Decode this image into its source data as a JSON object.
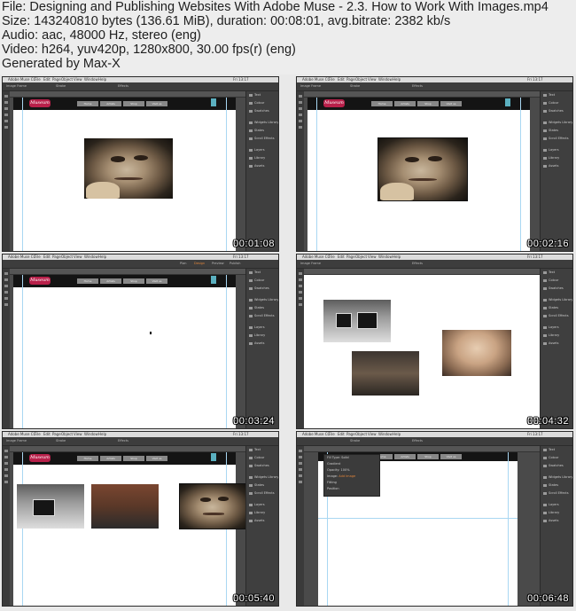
{
  "header": {
    "file_line": "File: Designing and Publishing Websites With Adobe Muse - 2.3. How to Work With Images.mp4",
    "size_line": "Size: 143240810 bytes (136.61 MiB), duration: 00:08:01, avg.bitrate: 2382 kb/s",
    "audio_line": "Audio: aac, 48000 Hz, stereo (eng)",
    "video_line": "Video: h264, yuv420p, 1280x800, 30.00 fps(r) (eng)",
    "generated_line": "Generated by Max-X"
  },
  "app": {
    "name": "Adobe Muse CC",
    "menu": [
      "File",
      "Edit",
      "Page",
      "Object",
      "View",
      "Window",
      "Help"
    ],
    "clock": "Fri 13:17",
    "modes": [
      "Plan",
      "Design",
      "Preview",
      "Publish"
    ],
    "options_label": "Image Frame",
    "options_fields": [
      "Stroke",
      "Effects",
      "Spacing",
      "Wrap"
    ],
    "site_logo": "Museum",
    "site_nav": [
      "Home",
      "Artists",
      "Shop",
      "Visit us"
    ],
    "panels": [
      "Text",
      "Colour",
      "Swatches",
      "Widgets Library",
      "States",
      "Scroll Effects",
      "Layers",
      "Library",
      "Assets"
    ],
    "dialog_rows": [
      "Fill Type",
      "Color",
      "Opacity",
      "Image",
      "Fitting",
      "Position"
    ],
    "dialog_values": [
      "Solid",
      "Gradient",
      "100%",
      "Add Image",
      "",
      ""
    ]
  },
  "thumbnails": [
    {
      "timestamp": "00:01:08"
    },
    {
      "timestamp": "00:02:16"
    },
    {
      "timestamp": "00:03:24"
    },
    {
      "timestamp": "00:04:32"
    },
    {
      "timestamp": "00:05:40"
    },
    {
      "timestamp": "00:06:48"
    }
  ],
  "colors": {
    "background": "#e9e9e9",
    "chrome": "#3d3d3d",
    "site_header": "#141414",
    "logo": "#b8204a",
    "guide": "#a9d7f2"
  }
}
